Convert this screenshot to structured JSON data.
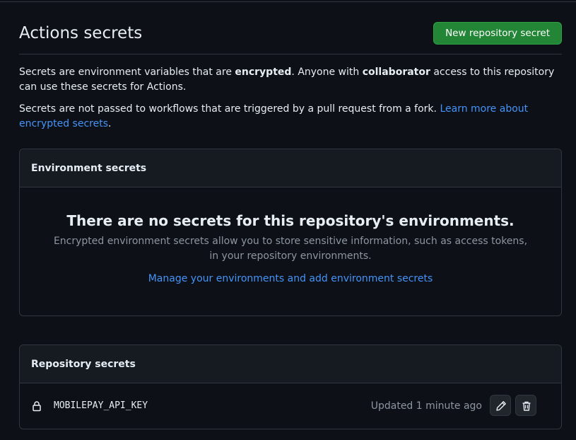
{
  "header": {
    "title": "Actions secrets",
    "new_secret_label": "New repository secret"
  },
  "intro": {
    "p1_before": "Secrets are environment variables that are ",
    "p1_bold1": "encrypted",
    "p1_middle": ". Anyone with ",
    "p1_bold2": "collaborator",
    "p1_after": " access to this repository can use these secrets for Actions.",
    "p2_text": "Secrets are not passed to workflows that are triggered by a pull request from a fork. ",
    "p2_link": "Learn more about encrypted secrets",
    "p2_end": "."
  },
  "environment_secrets": {
    "title": "Environment secrets",
    "empty_title": "There are no secrets for this repository's environments.",
    "empty_desc": "Encrypted environment secrets allow you to store sensitive information, such as access tokens, in your repository environments.",
    "manage_link": "Manage your environments and add environment secrets"
  },
  "repository_secrets": {
    "title": "Repository secrets",
    "items": [
      {
        "icon": "lock-icon",
        "name": "MOBILEPAY_API_KEY",
        "updated": "Updated 1 minute ago"
      }
    ]
  },
  "colors": {
    "background": "#0d1117",
    "accent_green": "#238636",
    "link": "#4493f8",
    "muted": "#8d96a0"
  }
}
